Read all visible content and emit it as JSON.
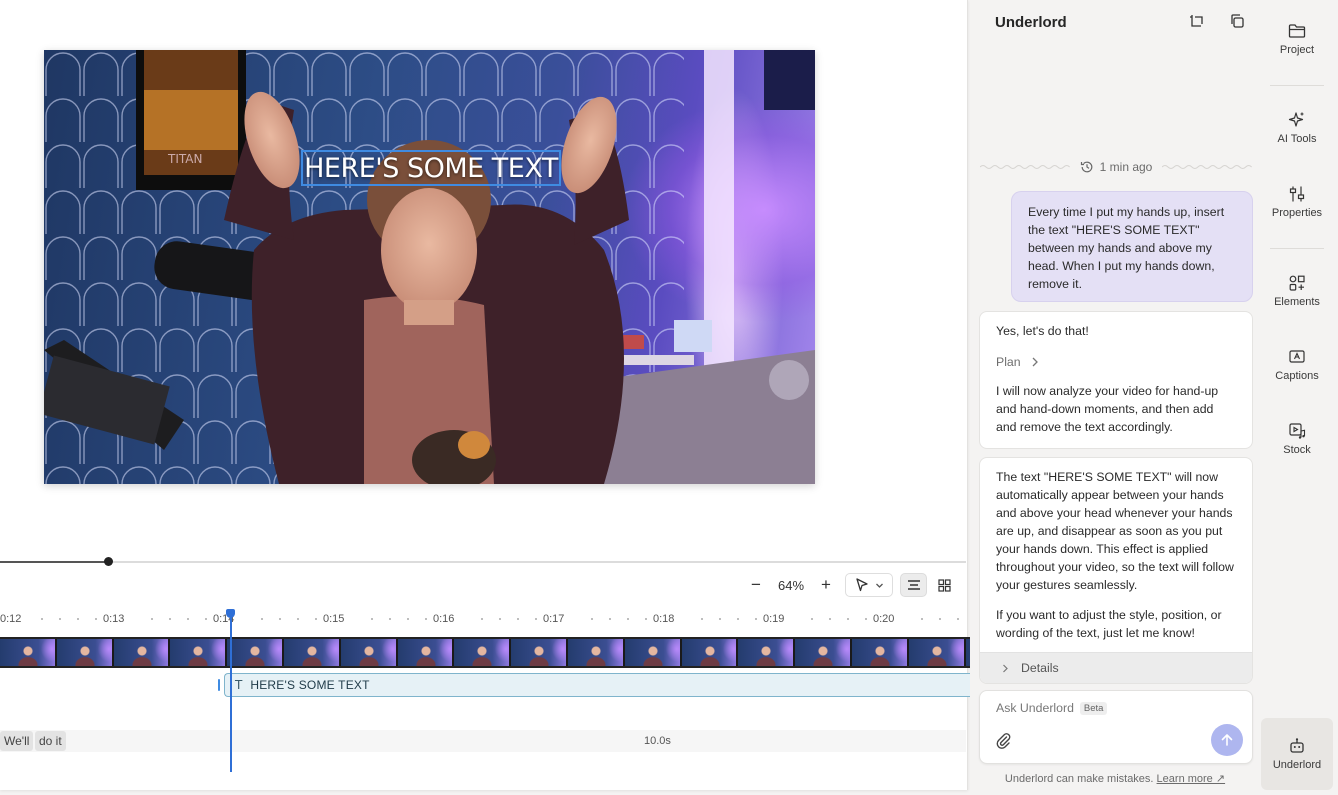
{
  "editor": {
    "overlay_text": "HERE'S SOME TEXT",
    "zoom": {
      "value": "64%",
      "minus": "−",
      "plus": "+"
    },
    "timeline": {
      "ticks": [
        "0:12",
        "0:13",
        "0:14",
        "0:15",
        "0:16",
        "0:17",
        "0:18",
        "0:19",
        "0:20"
      ],
      "text_clip_label": "HERE'S SOME TEXT",
      "text_clip_icon": "T",
      "words": [
        "We'll",
        "do it"
      ],
      "duration": "10.0s"
    },
    "playback_progress": 0.113
  },
  "panel": {
    "title": "Underlord",
    "time_ago": "1 min ago",
    "user_message": "Every time I put my hands up, insert the text \"HERE'S SOME TEXT\" between my hands and above my head. When I put my hands down, remove it.",
    "ai_messages": [
      {
        "intro": "Yes, let's do that!",
        "plan_label": "Plan",
        "body": "I will now analyze your video for hand-up and hand-down moments, and then add and remove the text accordingly."
      },
      {
        "para1": "The text \"HERE'S SOME TEXT\" will now automatically appear between your hands and above your head whenever your hands are up, and disappear as soon as you put your hands down. This effect is applied throughout your video, so the text will follow your gestures seamlessly.",
        "para2": "If you want to adjust the style, position, or wording of the text, just let me know!",
        "details_label": "Details"
      }
    ],
    "input": {
      "placeholder": "Ask Underlord",
      "badge": "Beta"
    },
    "disclaimer": "Underlord can make mistakes.",
    "learn_more": "Learn more ↗"
  },
  "rail": {
    "items": [
      {
        "label": "Project",
        "icon": "folder-icon"
      },
      {
        "label": "AI Tools",
        "icon": "sparkle-icon"
      },
      {
        "label": "Properties",
        "icon": "sliders-icon"
      },
      {
        "label": "Elements",
        "icon": "shapes-icon"
      },
      {
        "label": "Captions",
        "icon": "captions-icon"
      },
      {
        "label": "Stock",
        "icon": "stock-media-icon"
      },
      {
        "label": "Underlord",
        "icon": "robot-icon"
      }
    ]
  },
  "colors": {
    "accent": "#2f6fd6",
    "user_bubble": "#e4e0f5",
    "send_button": "#aeb6ef",
    "text_clip": "#e6f1f6"
  }
}
